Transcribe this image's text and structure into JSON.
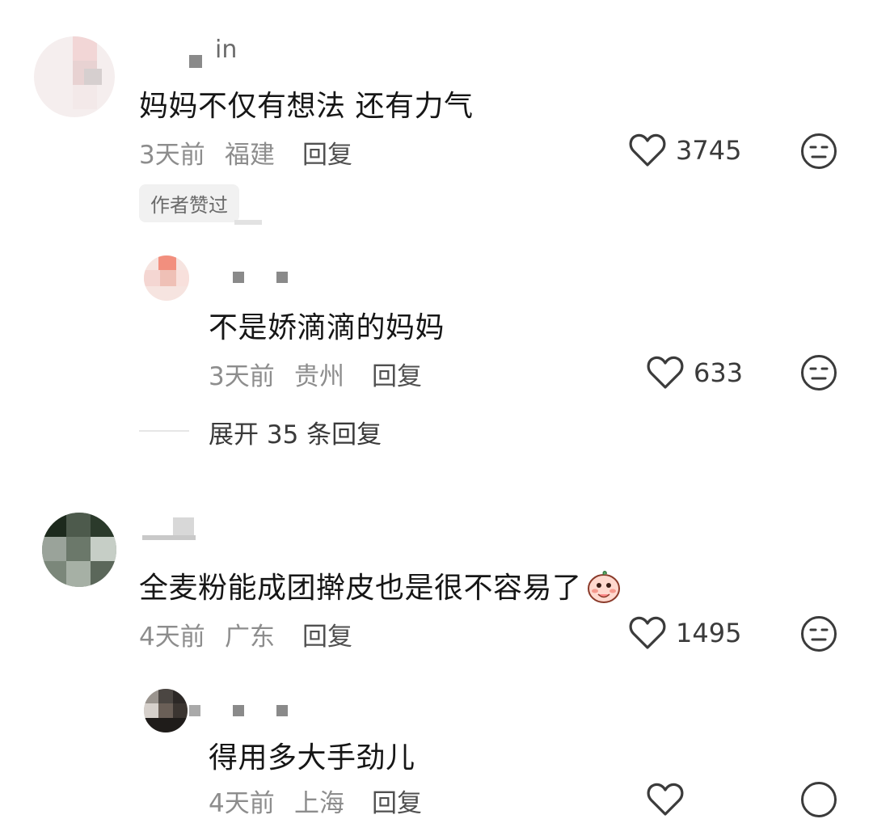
{
  "comments": [
    {
      "username": "in",
      "content": "妈妈不仅有想法 还有力气",
      "time": "3天前",
      "location": "福建",
      "reply_label": "回复",
      "likes": "3745",
      "badge": "作者赞过",
      "replies": [
        {
          "content": "不是娇滴滴的妈妈",
          "time": "3天前",
          "location": "贵州",
          "reply_label": "回复",
          "likes": "633"
        }
      ],
      "expand_label": "展开 35 条回复"
    },
    {
      "username": "",
      "content": "全麦粉能成团擀皮也是很不容易了",
      "emoji": "embarrassed-face",
      "time": "4天前",
      "location": "广东",
      "reply_label": "回复",
      "likes": "1495",
      "replies": [
        {
          "content": "得用多大手劲儿",
          "time": "4天前",
          "location": "上海",
          "reply_label": "回复"
        }
      ]
    }
  ],
  "icons": {
    "like": "heart-outline-icon",
    "dislike": "meh-face-icon"
  },
  "colors": {
    "text": "#161616",
    "meta": "#8d8d8d",
    "icon": "#3b3b3b"
  }
}
